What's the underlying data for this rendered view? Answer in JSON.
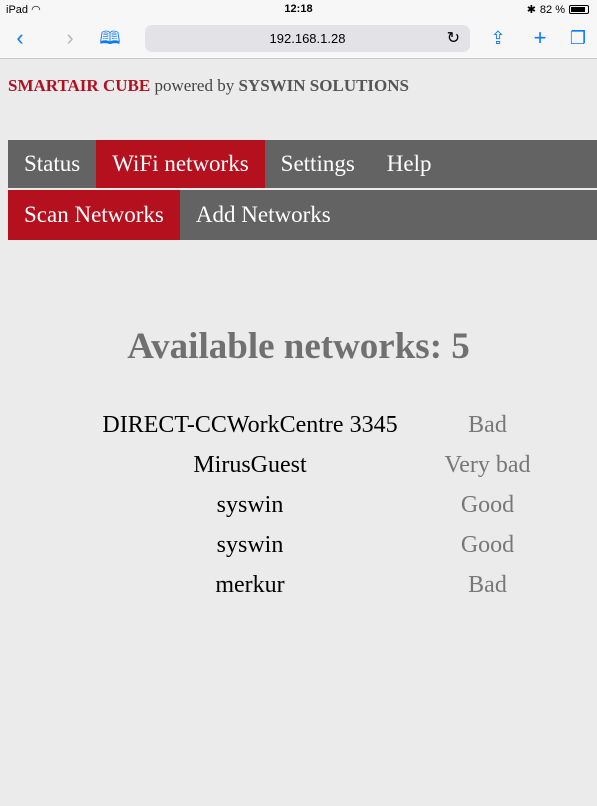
{
  "status_bar": {
    "device": "iPad",
    "wifi_icon": "wifi-icon",
    "time": "12:18",
    "battery": "82 %",
    "bluetooth_icon": "bluetooth-icon"
  },
  "browser": {
    "url": "192.168.1.28",
    "icons": [
      "back-icon",
      "forward-icon",
      "bookmarks-icon",
      "reload-icon",
      "share-icon",
      "new-tab-icon",
      "tabs-icon"
    ]
  },
  "brand": {
    "name": "SMARTAIR CUBE",
    "powered_by": "powered by",
    "company": "SYSWIN SOLUTIONS"
  },
  "nav": {
    "primary": [
      "Status",
      "WiFi networks",
      "Settings",
      "Help"
    ],
    "primary_active": "WiFi networks",
    "secondary": [
      "Scan Networks",
      "Add Networks"
    ],
    "secondary_active": "Scan Networks"
  },
  "main": {
    "heading": "Available networks: 5",
    "networks": [
      {
        "ssid": "DIRECT-CCWorkCentre 3345",
        "quality": "Bad"
      },
      {
        "ssid": "MirusGuest",
        "quality": "Very bad"
      },
      {
        "ssid": "syswin",
        "quality": "Good"
      },
      {
        "ssid": "syswin",
        "quality": "Good"
      },
      {
        "ssid": "merkur",
        "quality": "Bad"
      }
    ]
  },
  "colors": {
    "accent": "#b5101e",
    "nav_bg": "#636363",
    "page_bg": "#ebebeb",
    "ios_blue": "#0a7aff"
  }
}
